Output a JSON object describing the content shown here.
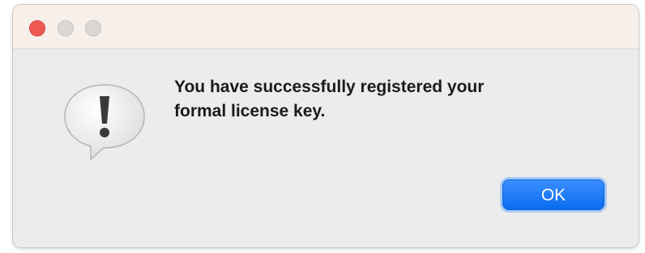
{
  "window": {
    "traffic_lights": [
      "close",
      "minimize",
      "maximize"
    ]
  },
  "alert": {
    "icon": "exclamation-speech-bubble-icon",
    "message": "You have successfully registered your\nformal license key.",
    "ok_label": "OK"
  },
  "colors": {
    "close": "#ee5a52",
    "inactive_light": "#dcd7d3",
    "accent": "#0a6cf0",
    "background": "#ececec"
  }
}
